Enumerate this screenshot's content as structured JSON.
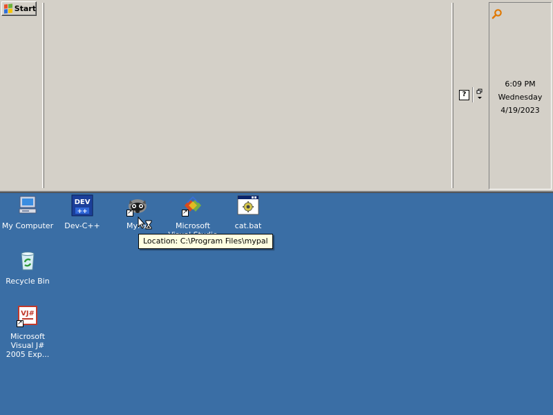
{
  "taskbar": {
    "start_label": "Start",
    "clock": {
      "time": "6:09 PM",
      "day": "Wednesday",
      "date": "4/19/2023"
    },
    "tray_icons": [
      "search-icon",
      "help-icon",
      "quicklaunch-overflow-icon"
    ]
  },
  "desktop": {
    "background_color": "#3a6ea5",
    "icons": [
      {
        "label": "My Computer",
        "icon": "computer-icon"
      },
      {
        "label": "Dev-C++",
        "icon": "devcpp-icon"
      },
      {
        "label": "MyPal",
        "icon": "mypal-icon"
      },
      {
        "label": "Microsoft Visual Studio 2005",
        "icon": "visual-studio-icon"
      },
      {
        "label": "cat.bat",
        "icon": "batch-file-icon"
      },
      {
        "label": "Recycle Bin",
        "icon": "recycle-bin-icon"
      },
      {
        "label": "Microsoft Visual J# 2005 Exp...",
        "icon": "visual-jsharp-icon"
      }
    ],
    "tooltip": "Location: C:\\Program Files\\mypal"
  }
}
